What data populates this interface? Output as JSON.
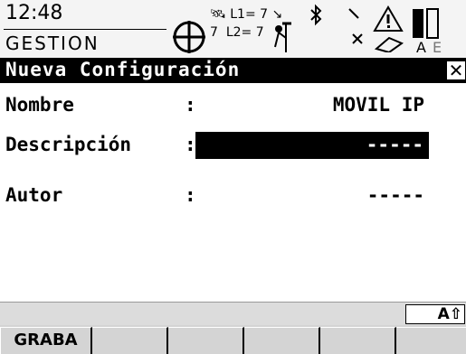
{
  "status": {
    "time": "12:48",
    "mode": "GESTION",
    "l1": "L1= 7",
    "l2": "L2= 7",
    "sat_count": "7",
    "battery_label": "A",
    "battery_label2": "E"
  },
  "title": "Nueva Configuración",
  "close_symbol": "✕",
  "fields": {
    "nombre": {
      "label": "Nombre",
      "colon": ":",
      "value": "MOVIL IP"
    },
    "descripcion": {
      "label": "Descripción",
      "colon": ":",
      "value": "-----"
    },
    "autor": {
      "label": "Autor",
      "colon": ":",
      "value": "-----"
    }
  },
  "input_mode": "A⇧",
  "softkeys": [
    "GRABA",
    "",
    "",
    "",
    "",
    ""
  ],
  "colors": {
    "highlight": "#000000",
    "background": "#ffffff",
    "softkey_bg": "#d4d4d4"
  }
}
